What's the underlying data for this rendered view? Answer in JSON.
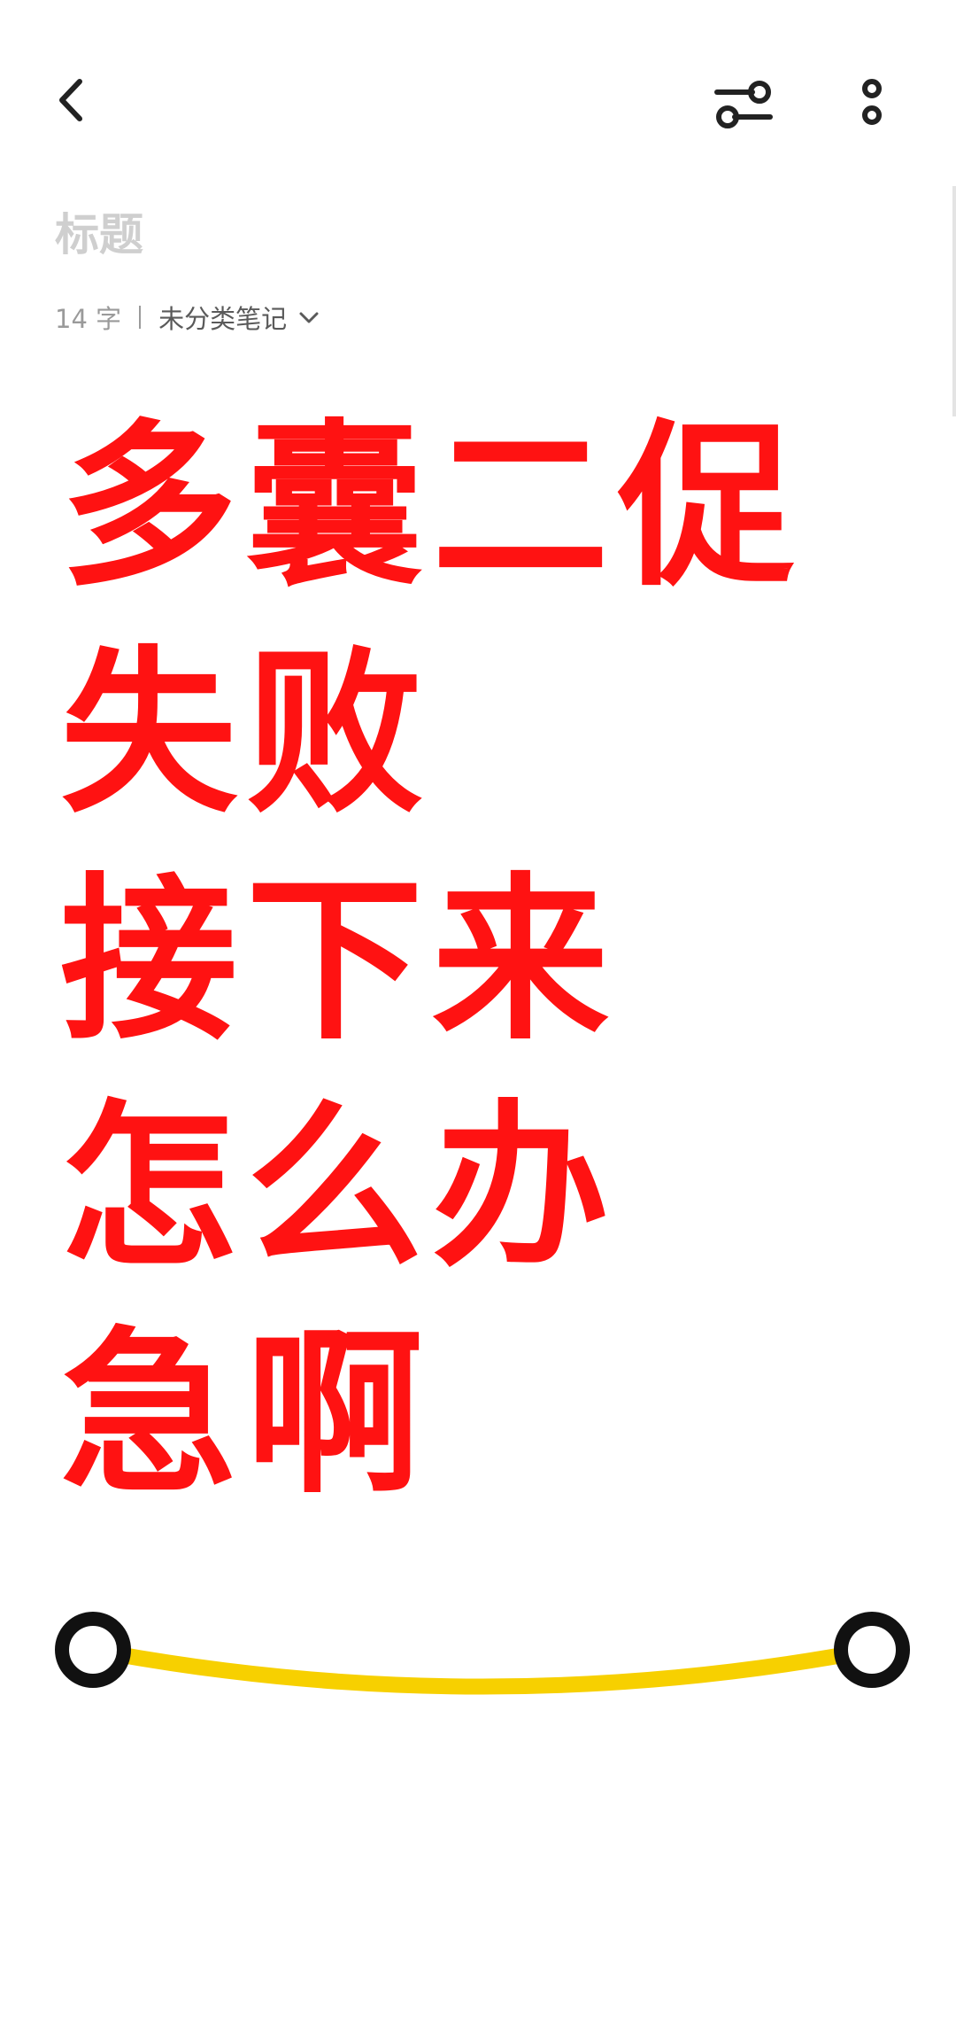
{
  "header": {
    "back_icon": "chevron-left-icon",
    "filter_icon": "sliders-toggle-icon",
    "more_icon": "vertical-ellipsis-icon"
  },
  "note": {
    "title_placeholder": "标题",
    "word_count": "14 字",
    "category": "未分类笔记",
    "category_icon": "chevron-down-icon",
    "lines": [
      "多囊二促",
      "失败",
      "接下来",
      "怎么办",
      "急啊"
    ]
  },
  "decor": {
    "smile_icon": "smile-curve-icon",
    "smile_color": "#f7d000",
    "text_color": "#ff1212"
  }
}
